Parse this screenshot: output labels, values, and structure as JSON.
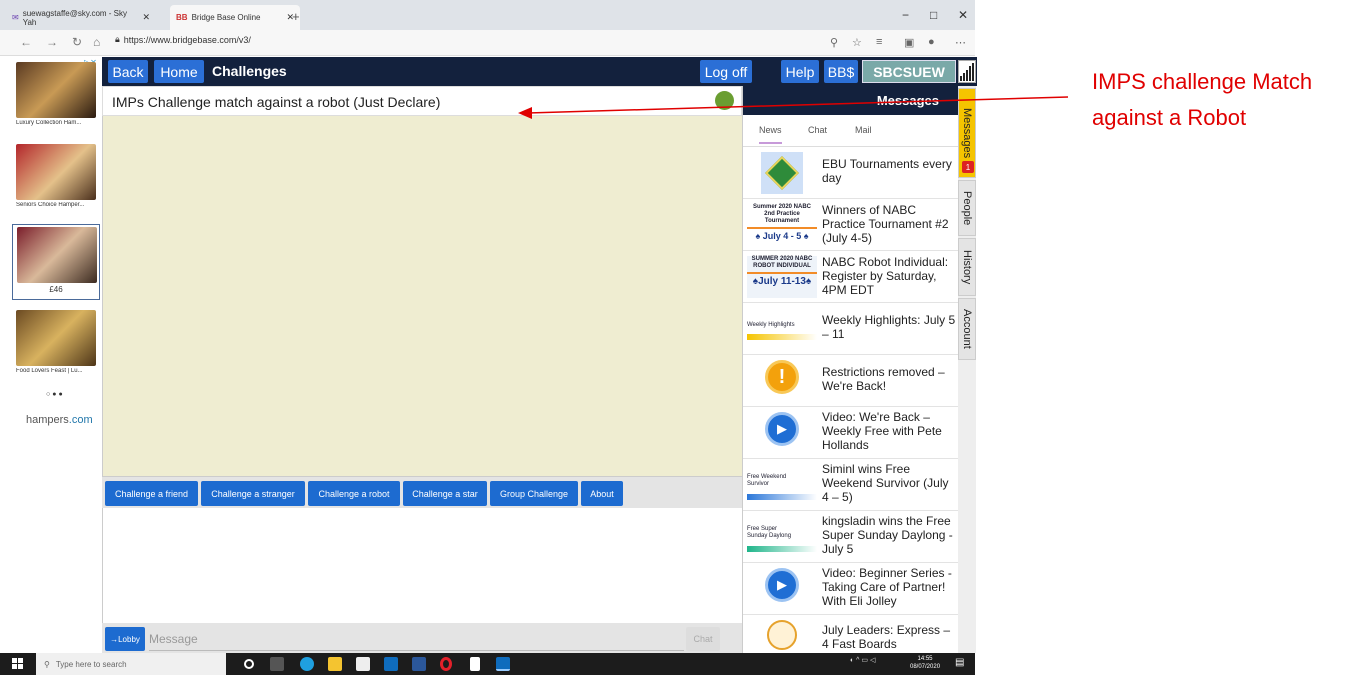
{
  "browser": {
    "tabs": [
      {
        "label": "suewagstaffe@sky.com - Sky Yah"
      },
      {
        "label": "Bridge Base Online"
      }
    ],
    "url": "https://www.bridgebase.com/v3/"
  },
  "ads": {
    "items": [
      {
        "label": "Luxury Collection Ham..."
      },
      {
        "label": "Seniors Choice Hamper..."
      },
      {
        "label": "£46"
      },
      {
        "label": "Food Lovers Feast | Lu..."
      }
    ],
    "brand_a": "hampers",
    "brand_b": ".com"
  },
  "topbar": {
    "back": "Back",
    "home": "Home",
    "title": "Challenges",
    "logoff": "Log off",
    "help": "Help",
    "bbs": "BB$",
    "username": "SBCSUEW"
  },
  "challenge": {
    "header": "IMPs Challenge match against a robot (Just Declare)",
    "buttons": [
      "Challenge a friend",
      "Challenge a stranger",
      "Challenge a robot",
      "Challenge a star",
      "Group Challenge",
      "About"
    ],
    "lobby": "→Lobby",
    "placeholder": "Message",
    "send": "Chat"
  },
  "messages": {
    "title": "Messages",
    "tabs": [
      "News",
      "Chat",
      "Mail"
    ],
    "news": [
      {
        "text": "EBU Tournaments every day",
        "thumb": "ebu-logo"
      },
      {
        "text": "Winners of NABC Practice Tournament #2 (July 4-5)",
        "thumb": "nabc-practice",
        "thumb_l1": "Summer 2020 NABC",
        "thumb_l2": "2nd Practice Tournament",
        "thumb_l3": "♠ July 4 - 5 ♠"
      },
      {
        "text": "NABC Robot Individual: Register by Saturday, 4PM EDT",
        "thumb": "nabc-robot",
        "thumb_l1": "SUMMER 2020 NABC",
        "thumb_l2": "ROBOT INDIVIDUAL",
        "thumb_l3": "♠July 11-13♠"
      },
      {
        "text": "Weekly Highlights: July 5 – 11",
        "thumb": "weekly-highlights",
        "thumb_l1": "Weekly Highlights"
      },
      {
        "text": "Restrictions removed – We're Back!",
        "thumb": "warning-icon"
      },
      {
        "text": "Video: We're Back – Weekly Free with Pete Hollands",
        "thumb": "video-icon"
      },
      {
        "text": "Siminl wins Free Weekend Survivor (July 4 – 5)",
        "thumb": "free-weekend",
        "thumb_l1": "Free Weekend",
        "thumb_l2": "Survivor"
      },
      {
        "text": "kingsladin wins the Free Super Sunday Daylong - July 5",
        "thumb": "super-sunday",
        "thumb_l1": "Free Super",
        "thumb_l2": "Sunday Daylong"
      },
      {
        "text": "Video: Beginner Series - Taking Care of Partner! With Eli Jolley",
        "thumb": "video-icon"
      },
      {
        "text": "July Leaders: Express – 4 Fast Boards",
        "thumb": "globe-icon"
      }
    ]
  },
  "sidetabs": [
    {
      "label": "Messages",
      "badge": "1"
    },
    {
      "label": "People"
    },
    {
      "label": "History"
    },
    {
      "label": "Account"
    }
  ],
  "annotation": {
    "line1": "IMPS challenge Match",
    "line2": "against a Robot",
    "color": "#e00000"
  },
  "taskbar": {
    "search": "Type here to search",
    "time": "14:55",
    "date": "08/07/2020"
  }
}
